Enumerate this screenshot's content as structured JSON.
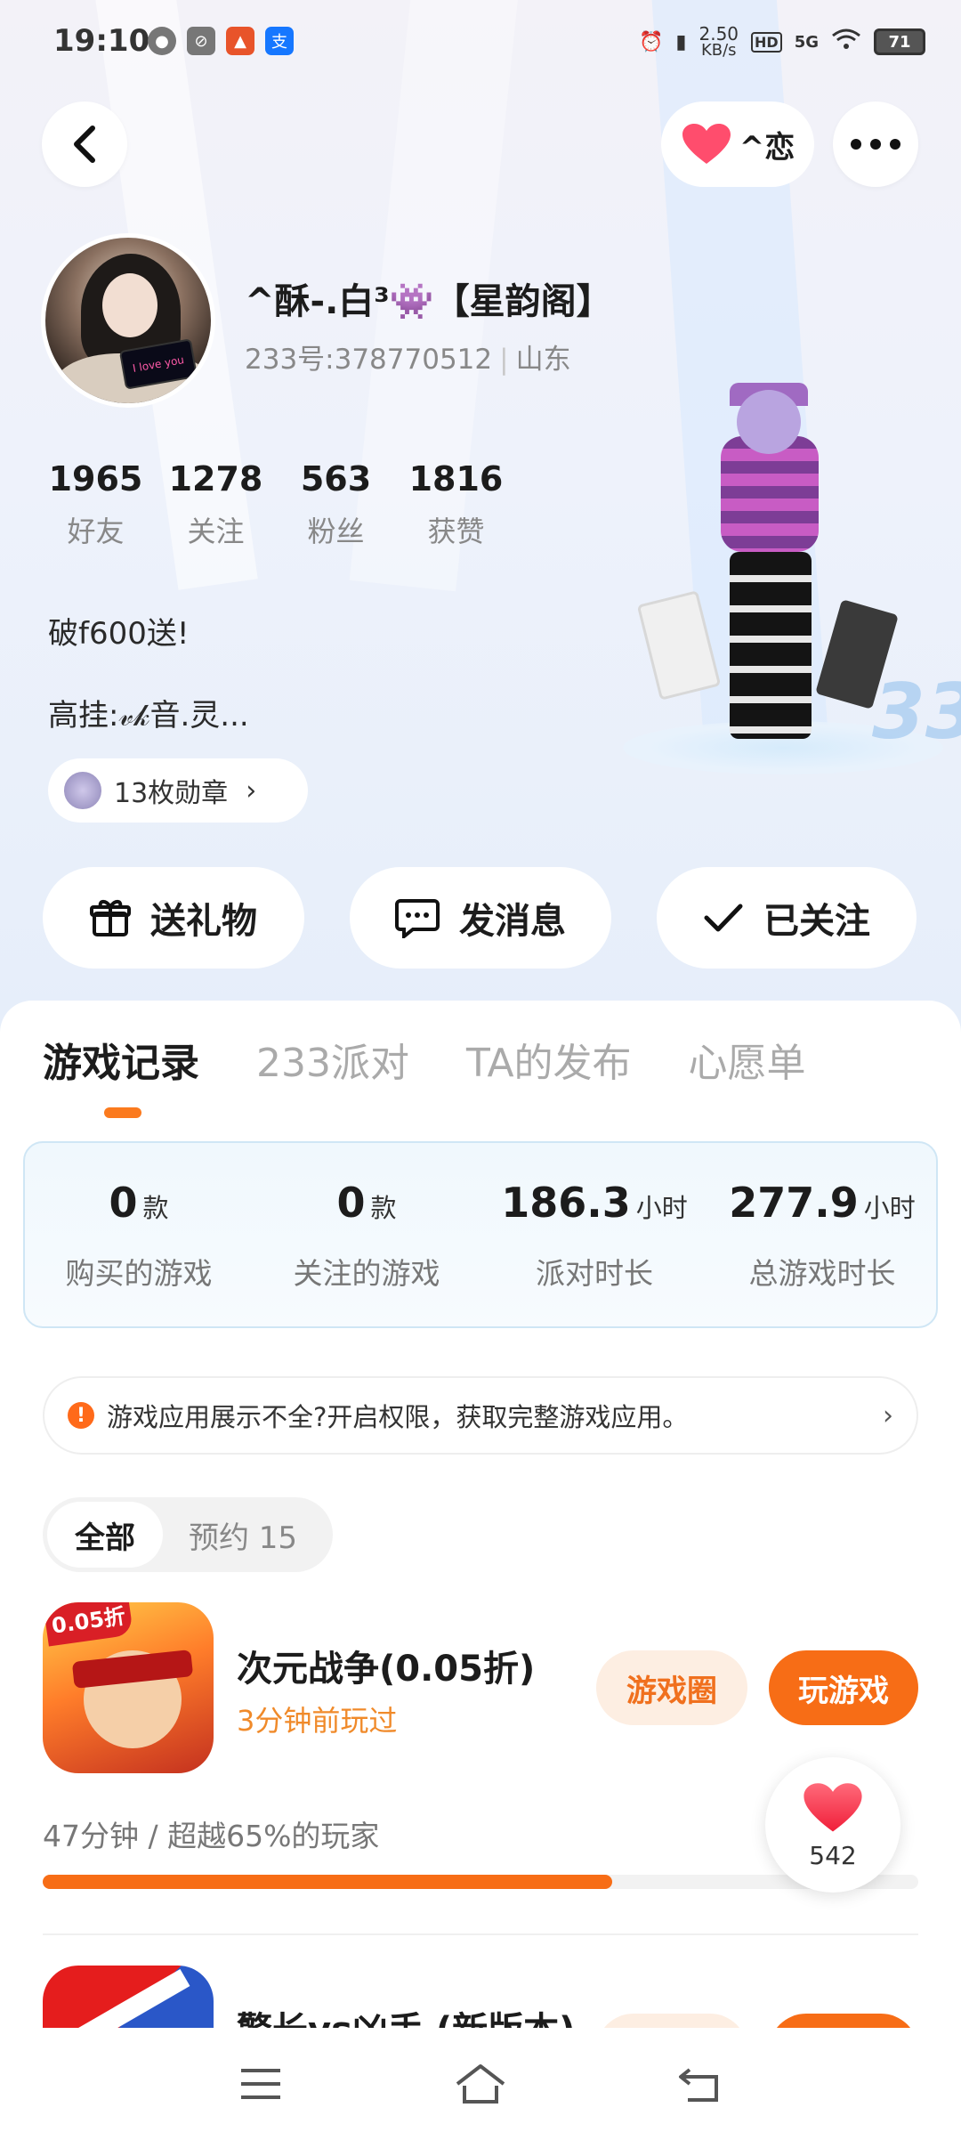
{
  "status_bar": {
    "time": "19:10",
    "net_speed_value": "2.50",
    "net_speed_unit": "KB/s",
    "hd": "HD",
    "signal": "5G",
    "battery": "71"
  },
  "top_nav": {
    "love_label": "^恋"
  },
  "profile": {
    "name": "^酥-.白³👾【星韵阁】",
    "id_text": "233号:378770512",
    "location": "山东",
    "avatar_screen_text": "I love you"
  },
  "stats": [
    {
      "value": "1965",
      "label": "好友"
    },
    {
      "value": "1278",
      "label": "关注"
    },
    {
      "value": "563",
      "label": "粉丝"
    },
    {
      "value": "1816",
      "label": "获赞"
    }
  ],
  "bio": {
    "line1": "破f600送!",
    "line2": "高挂:𝓋𝓀音.灵..."
  },
  "medals": {
    "label": "13枚勋章"
  },
  "actions": {
    "gift": "送礼物",
    "message": "发消息",
    "follow": "已关注"
  },
  "tabs": [
    "游戏记录",
    "233派对",
    "TA的发布",
    "心愿单"
  ],
  "summary": [
    {
      "value": "0",
      "unit": "款",
      "label": "购买的游戏"
    },
    {
      "value": "0",
      "unit": "款",
      "label": "关注的游戏"
    },
    {
      "value": "186.3",
      "unit": "小时",
      "label": "派对时长"
    },
    {
      "value": "277.9",
      "unit": "小时",
      "label": "总游戏时长"
    }
  ],
  "notice": {
    "text": "游戏应用展示不全?开启权限，获取完整游戏应用。"
  },
  "filter": {
    "all": "全部",
    "reserved": "预约 15"
  },
  "games": [
    {
      "title": "次元战争(0.05折)",
      "subtitle": "3分钟前玩过",
      "icon_badge": "0.05折",
      "circle_button": "游戏圈",
      "play_button": "玩游戏",
      "progress_text": "47分钟 / 超越65%的玩家",
      "progress_fraction": 0.65
    },
    {
      "title": "警长vs凶手 (新版本)"
    }
  ],
  "like_float": {
    "count": "542"
  },
  "colors": {
    "accent": "#f76d16",
    "accent_light": "#fdeee2",
    "heart": "#ff3b55"
  }
}
